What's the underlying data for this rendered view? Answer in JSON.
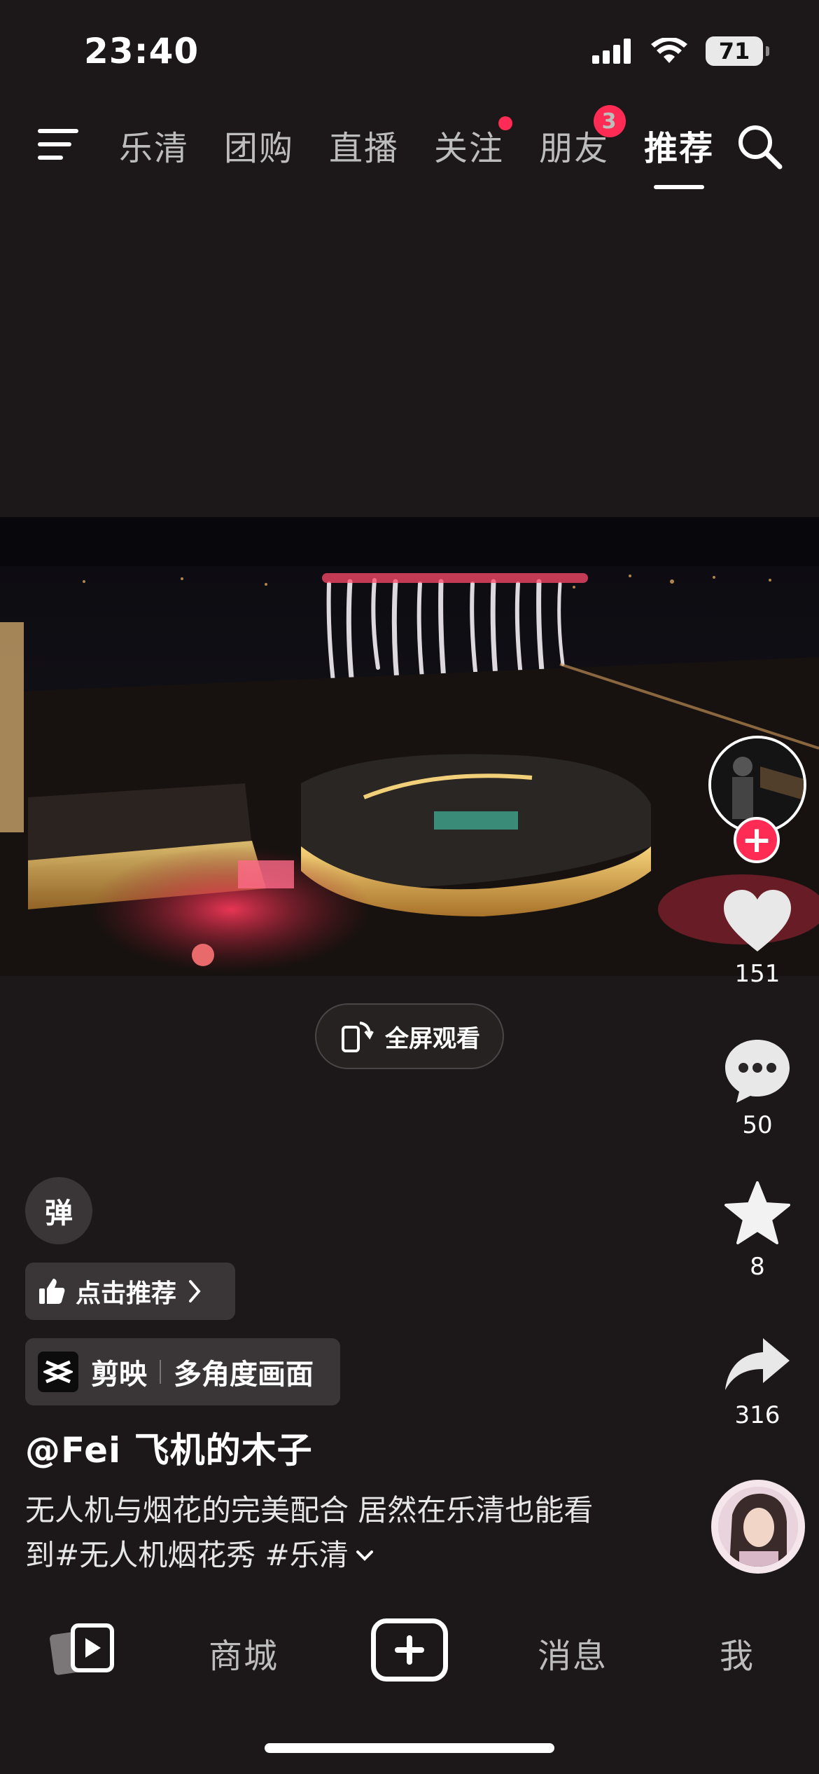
{
  "status_bar": {
    "time": "23:40",
    "battery": "71",
    "icons": [
      "signal-icon",
      "wifi-icon",
      "battery-icon"
    ]
  },
  "top_nav": {
    "tabs": [
      {
        "label": "乐清",
        "active": false
      },
      {
        "label": "团购",
        "active": false
      },
      {
        "label": "直播",
        "active": false
      },
      {
        "label": "关注",
        "active": false,
        "dot": true
      },
      {
        "label": "朋友",
        "active": false,
        "badge": "3"
      },
      {
        "label": "推荐",
        "active": true
      }
    ],
    "icons": [
      "menu-icon",
      "search-icon"
    ]
  },
  "video": {
    "fullscreen_label": "全屏观看"
  },
  "actions": {
    "likes": "151",
    "comments": "50",
    "favorites": "8",
    "shares": "316"
  },
  "info": {
    "danmu_label": "弹",
    "recommend_label": "点击推荐",
    "capcut_app": "剪映",
    "capcut_feature": "多角度画面",
    "username": "@Fei 飞机的木子",
    "caption_line1": "无人机与烟花的完美配合 居然在乐清也能看",
    "caption_line2": "到#无人机烟花秀 #乐清"
  },
  "bottom_nav": {
    "mall": "商城",
    "messages": "消息",
    "me": "我"
  },
  "colors": {
    "accent": "#fe2c55",
    "background": "#1c1819",
    "chip": "#3a3637"
  }
}
